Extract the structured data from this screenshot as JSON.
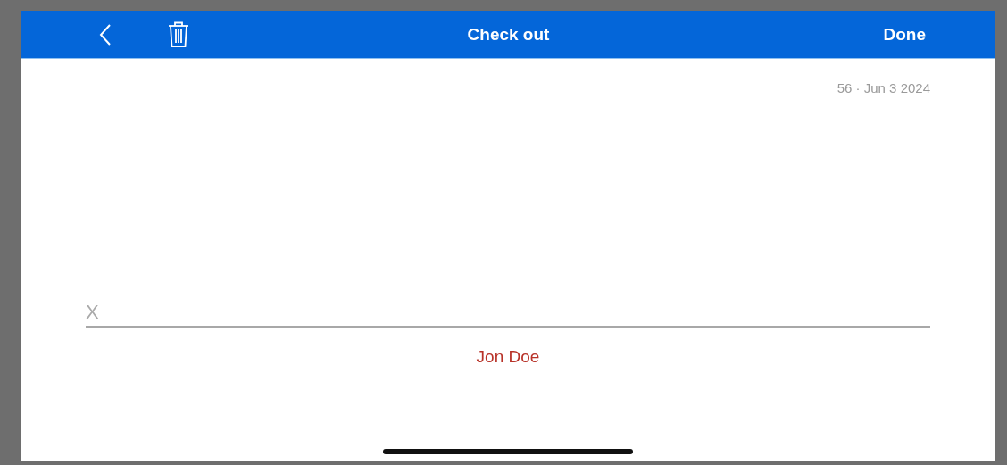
{
  "nav_bar": {
    "title": "Check out",
    "done_button": "Done"
  },
  "meta": "56 · Jun 3 2024",
  "signature": {
    "placeholder": "X",
    "signer_name": "Jon Doe"
  }
}
